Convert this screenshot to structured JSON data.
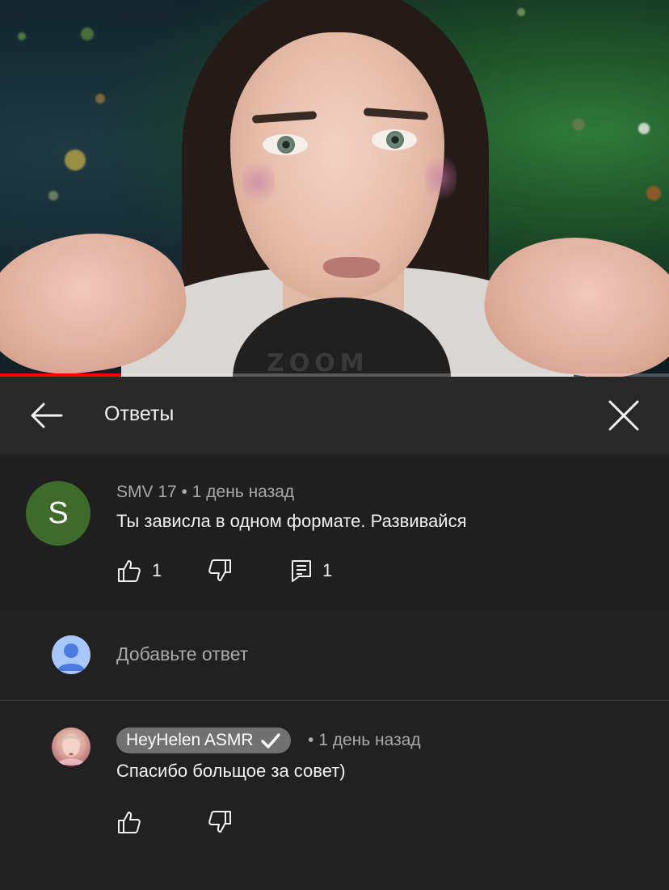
{
  "video": {
    "mic_brand": "ZOOM",
    "progress_fraction": 0.18,
    "colors": {
      "progress": "#ff0000",
      "track": "#6b6b6b"
    }
  },
  "header": {
    "title": "Ответы",
    "back_icon": "arrow-left-icon",
    "close_icon": "close-icon"
  },
  "parent_comment": {
    "avatar_letter": "S",
    "avatar_color": "#3f6b2a",
    "author": "SMV 17",
    "separator": "•",
    "time": "1 день назад",
    "text": "Ты зависла в одном формате. Развивайся",
    "likes": "1",
    "replies": "1",
    "icons": [
      "thumb-up-icon",
      "thumb-down-icon",
      "reply-icon"
    ]
  },
  "add_reply": {
    "placeholder": "Добавьте ответ",
    "avatar_icon": "user-avatar-icon"
  },
  "reply": {
    "author": "HeyHelen ASMR",
    "verified_icon": "checkmark-icon",
    "separator": "•",
    "time": "1 день назад",
    "text": "Спасибо больщое за совет)",
    "icons": [
      "thumb-up-icon",
      "thumb-down-icon"
    ]
  }
}
